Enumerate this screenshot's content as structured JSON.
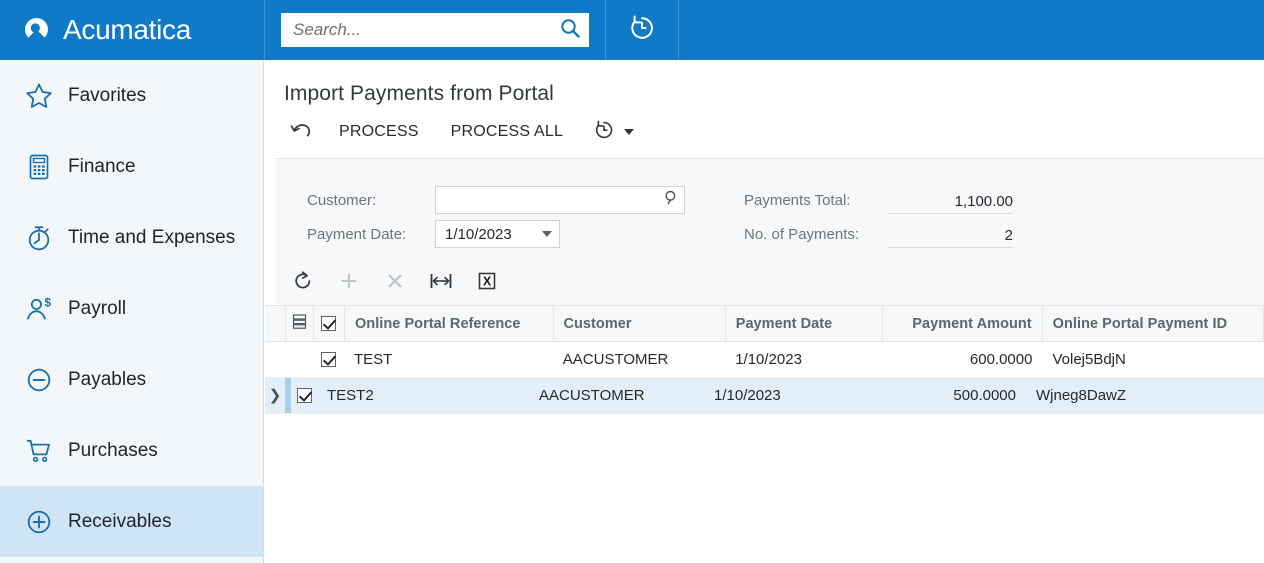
{
  "brand": {
    "name": "Acumatica",
    "logo_icon": "acumatica-drop-logo",
    "header_bg": "#0f7ac7"
  },
  "search": {
    "placeholder": "Search...",
    "value": "",
    "icon": "search-icon"
  },
  "topbar": {
    "recent_icon": "clock-history-icon"
  },
  "sidebar": {
    "items": [
      {
        "label": "Favorites",
        "icon": "star-icon",
        "active": false
      },
      {
        "label": "Finance",
        "icon": "calculator-icon",
        "active": false
      },
      {
        "label": "Time and Expenses",
        "icon": "stopwatch-icon",
        "active": false
      },
      {
        "label": "Payroll",
        "icon": "person-dollar-icon",
        "active": false
      },
      {
        "label": "Payables",
        "icon": "minus-circle-icon",
        "active": false
      },
      {
        "label": "Purchases",
        "icon": "shopping-cart-icon",
        "active": false
      },
      {
        "label": "Receivables",
        "icon": "plus-circle-icon",
        "active": true
      }
    ],
    "active_bg": "#cfe5f5"
  },
  "page": {
    "title": "Import Payments from Portal"
  },
  "command_bar": {
    "undo_icon": "undo-arrow-icon",
    "process_label": "PROCESS",
    "process_all_label": "PROCESS ALL",
    "schedule_icon": "clock-schedule-icon",
    "dropdown_icon": "chevron-down-icon"
  },
  "form": {
    "customer": {
      "label": "Customer:",
      "value": "",
      "selector_icon": "magnifier-selector-icon"
    },
    "payment_date": {
      "label": "Payment Date:",
      "value": "1/10/2023",
      "dropdown_icon": "chevron-down-icon"
    },
    "payments_total": {
      "label": "Payments Total:",
      "value": "1,100.00"
    },
    "no_of_payments": {
      "label": "No. of Payments:",
      "value": "2"
    }
  },
  "grid_toolbar": {
    "buttons": [
      {
        "name": "refresh",
        "icon": "refresh-icon",
        "enabled": true
      },
      {
        "name": "add-row",
        "icon": "plus-icon",
        "enabled": false
      },
      {
        "name": "delete-row",
        "icon": "close-x-icon",
        "enabled": false
      },
      {
        "name": "fit-column-width",
        "icon": "fit-width-icon",
        "enabled": true
      },
      {
        "name": "export-to-excel",
        "icon": "excel-export-icon",
        "enabled": true
      }
    ]
  },
  "grid": {
    "select_all_checked": true,
    "column_config_icon": "column-settings-icon",
    "columns": [
      {
        "key": "reference",
        "label": "Online Portal Reference",
        "align": "left"
      },
      {
        "key": "customer",
        "label": "Customer",
        "align": "left"
      },
      {
        "key": "date",
        "label": "Payment Date",
        "align": "left"
      },
      {
        "key": "amount",
        "label": "Payment Amount",
        "align": "right"
      },
      {
        "key": "portal_id",
        "label": "Online Portal Payment ID",
        "align": "left"
      }
    ],
    "rows": [
      {
        "selected": false,
        "checked": true,
        "reference": "TEST",
        "customer": "AACUSTOMER",
        "date": "1/10/2023",
        "amount": "600.0000",
        "portal_id": "Volej5BdjN"
      },
      {
        "selected": true,
        "checked": true,
        "reference": "TEST2",
        "customer": "AACUSTOMER",
        "date": "1/10/2023",
        "amount": "500.0000",
        "portal_id": "Wjneg8DawZ"
      }
    ]
  }
}
